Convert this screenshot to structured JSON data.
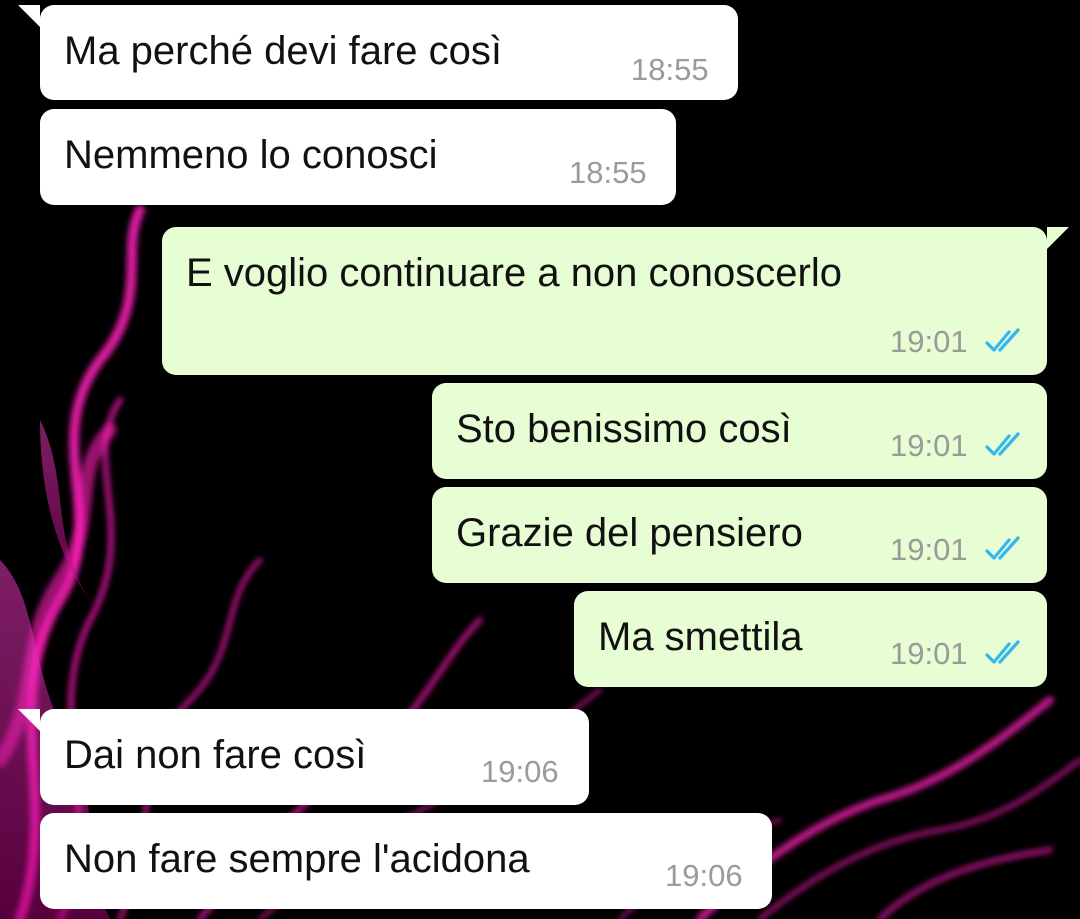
{
  "conversation": {
    "messages": [
      {
        "direction": "incoming",
        "text": "Ma perché devi fare così",
        "time": "18:55"
      },
      {
        "direction": "incoming",
        "text": "Nemmeno lo conosci",
        "time": "18:55"
      },
      {
        "direction": "outgoing",
        "text": "E voglio continuare a non conoscerlo",
        "time": "19:01",
        "status_icon": "double-check-read-icon"
      },
      {
        "direction": "outgoing",
        "text": "Sto benissimo così",
        "time": "19:01",
        "status_icon": "double-check-read-icon"
      },
      {
        "direction": "outgoing",
        "text": "Grazie del pensiero",
        "time": "19:01",
        "status_icon": "double-check-read-icon"
      },
      {
        "direction": "outgoing",
        "text": "Ma smettila",
        "time": "19:01",
        "status_icon": "double-check-read-icon"
      },
      {
        "direction": "incoming",
        "text": "Dai non fare così",
        "time": "19:06"
      },
      {
        "direction": "incoming",
        "text": "Non fare sempre l'acidona",
        "time": "19:06"
      }
    ]
  },
  "colors": {
    "wallpaper_background": "#000000",
    "wallpaper_accent": "#ff1fb8",
    "incoming_bubble": "#ffffff",
    "outgoing_bubble": "#e7fdd3",
    "read_ticks": "#34b7f1",
    "timestamp": "#9a9a9a"
  }
}
